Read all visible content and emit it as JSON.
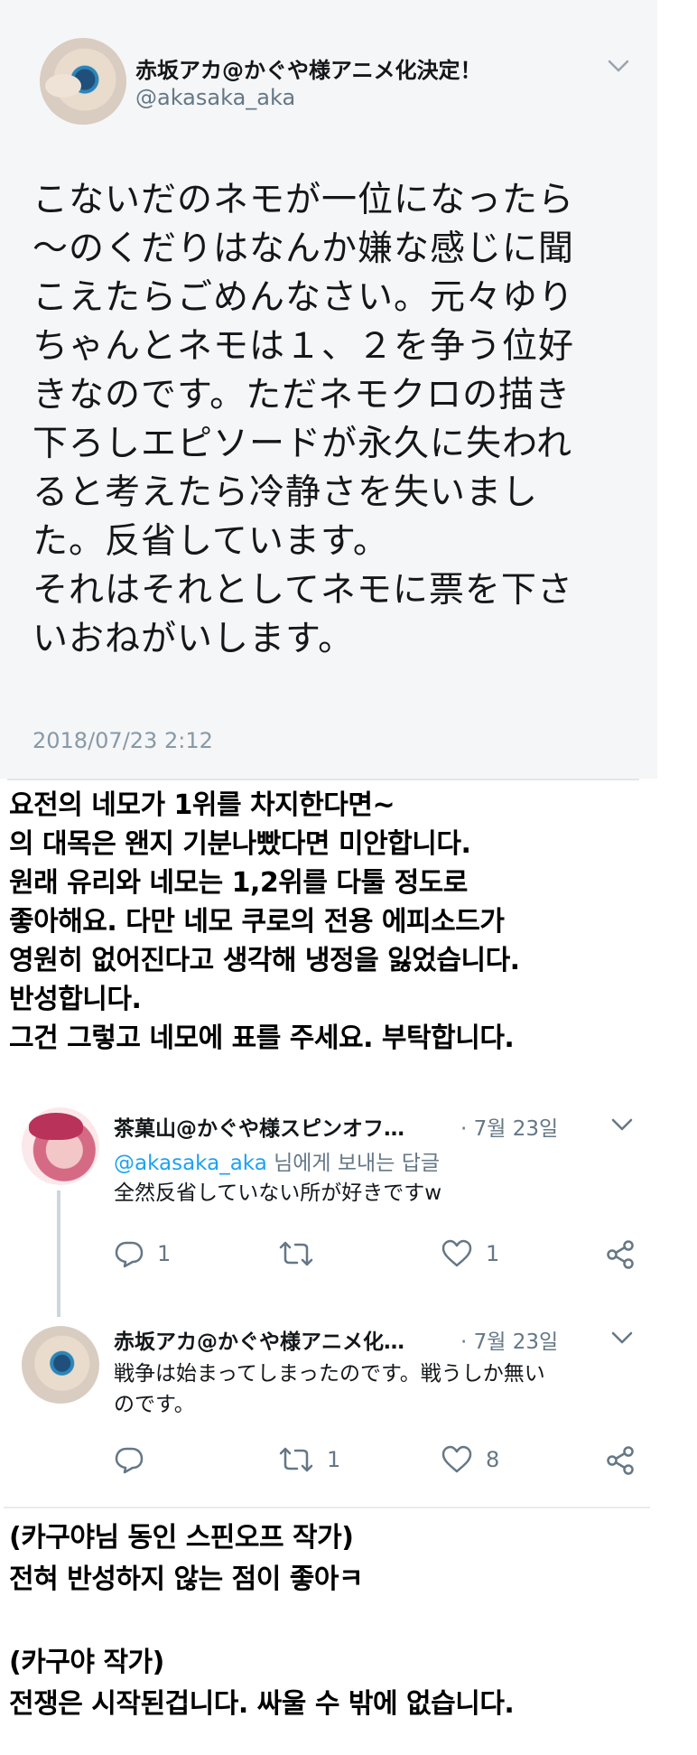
{
  "main_tweet": {
    "display_name": "赤坂アカ@かぐや様アニメ化決定！",
    "handle": "@akasaka_aka",
    "lines": [
      "こないだのネモが一位になったら",
      "〜のくだりはなんか嫌な感じに聞",
      "こえたらごめんなさい。元々ゆり",
      "ちゃんとネモは１、２を争う位好",
      "きなのです。ただネモクロの描き",
      "下ろしエピソードが永久に失われ",
      "ると考えたら冷静さを失いまし",
      "た。反省しています。",
      "それはそれとしてネモに票を下さ",
      "いおねがいします。"
    ],
    "timestamp": "2018/07/23 2:12"
  },
  "translation_1": {
    "lines": [
      "요전의 네모가 1위를 차지한다면~",
      "의 대목은 왠지 기분나빴다면 미안합니다.",
      "원래 유리와 네모는 1,2위를 다툴 정도로",
      "좋아해요. 다만 네모 쿠로의 전용 에피소드가",
      "영원히 없어진다고 생각해 냉정을 잃었습니다.",
      "반성합니다.",
      "그건 그렇고 네모에 표를 주세요. 부탁합니다."
    ]
  },
  "replies": [
    {
      "display_name": "茶菓山@かぐや様スピンオフ…",
      "separator": "·",
      "date": "7월 23일",
      "reply_to_mention": "@akasaka_aka",
      "reply_to_suffix": " 님에게 보내는 답글",
      "text_lines": [
        "全然反省していない所が好きですw"
      ],
      "reply_count": "1",
      "retweet_count": "",
      "like_count": "1"
    },
    {
      "display_name": "赤坂アカ@かぐや様アニメ化…",
      "separator": "·",
      "date": "7월 23일",
      "text_lines": [
        "戦争は始まってしまったのです。戦うしか無い",
        "のです。"
      ],
      "reply_count": "",
      "retweet_count": "1",
      "like_count": "8"
    }
  ],
  "translation_2": {
    "lines": [
      "(카구야님 동인 스핀오프 작가)",
      "전혀 반성하지 않는 점이 좋아ㅋ",
      "",
      "(카구야 작가)",
      "전쟁은 시작된겁니다. 싸울 수 밖에 없습니다."
    ]
  },
  "colors": {
    "card_background": "#f5f6f7",
    "secondary_text": "#657786",
    "mention_blue": "#1da1f2",
    "icon_gray": "#657786"
  },
  "icons": [
    "chevron-down-icon",
    "reply-icon",
    "retweet-icon",
    "like-icon",
    "share-icon"
  ]
}
